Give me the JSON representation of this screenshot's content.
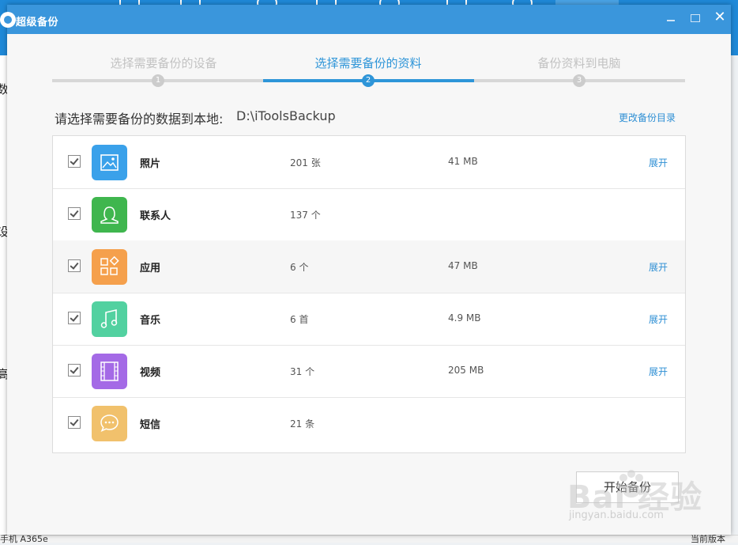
{
  "window": {
    "title": "超级备份"
  },
  "steps": [
    {
      "label": "选择需要备份的设备",
      "number": "1"
    },
    {
      "label": "选择需要备份的资料",
      "number": "2"
    },
    {
      "label": "备份资料到电脑",
      "number": "3"
    }
  ],
  "backup_path": {
    "label": "请选择需要备份的数据到本地:",
    "value": "D:\\iToolsBackup",
    "change_label": "更改备份目录"
  },
  "items": [
    {
      "name": "照片",
      "count": "201 张",
      "size": "41 MB",
      "expand": "展开",
      "icon": "photo-icon",
      "color": "#3aa1ea",
      "checked": true
    },
    {
      "name": "联系人",
      "count": "137 个",
      "size": "",
      "expand": "",
      "icon": "contacts-icon",
      "color": "#3fb64e",
      "checked": true
    },
    {
      "name": "应用",
      "count": "6 个",
      "size": "47 MB",
      "expand": "展开",
      "icon": "apps-icon",
      "color": "#f5a04c",
      "checked": true
    },
    {
      "name": "音乐",
      "count": "6 首",
      "size": "4.9 MB",
      "expand": "展开",
      "icon": "music-icon",
      "color": "#52d1a0",
      "checked": true
    },
    {
      "name": "视频",
      "count": "31 个",
      "size": "205 MB",
      "expand": "展开",
      "icon": "video-icon",
      "color": "#a46ae6",
      "checked": true
    },
    {
      "name": "短信",
      "count": "21 条",
      "size": "",
      "expand": "",
      "icon": "sms-icon",
      "color": "#f1c16c",
      "checked": true
    }
  ],
  "start_button": {
    "label": "开始备份"
  },
  "background": {
    "left_chars": [
      "数",
      "设",
      "高"
    ],
    "status_left": "手机 A365e",
    "status_right": "当前版本"
  },
  "watermark": {
    "text": "Bai 经验",
    "sub": "jingyan.baidu.com"
  },
  "colors": {
    "accent": "#2e95d8",
    "titlebar": "#3a96dc",
    "inactive_step": "#c2c2c2"
  }
}
